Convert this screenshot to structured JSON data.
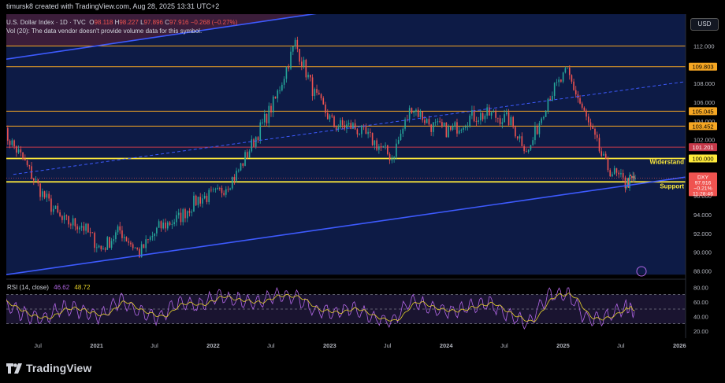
{
  "header": {
    "caption": "timursk8 created with TradingView.com, Aug 28, 2025 13:31 UTC+2",
    "symbol_title": "U.S. Dollar Index · 1D · TVC",
    "ohlc": {
      "o_label": "O",
      "o": "98.118",
      "h_label": "H",
      "h": "98.227",
      "l_label": "L",
      "l": "97.896",
      "c_label": "C",
      "c": "97.916",
      "change": "−0.268 (−0.27%)"
    },
    "volume_note": "Vol (20): The data vendor doesn't provide volume data for this symbol.",
    "currency": "USD"
  },
  "footer": {
    "brand": "TradingView"
  },
  "colors": {
    "background": "#000000",
    "channel_fill": "#0d1b46",
    "top_zone": "#3b1d3a",
    "channel_line": "#3d5afe",
    "yellow_line": "#ffeb3b",
    "orange_line": "#f5a623",
    "red_line": "#c6394a",
    "up_candle": "#26a69a",
    "down_candle": "#ef5350",
    "rsi_line": "#b267e6",
    "rsi_ma": "#e6d22a"
  },
  "chart_data": {
    "type": "line",
    "symbol": "DXY",
    "price_axis": {
      "ticks": [
        "114.000",
        "112.000",
        "110.000",
        "108.000",
        "106.000",
        "104.000",
        "102.000",
        "100.000",
        "98.000",
        "96.000",
        "94.000",
        "92.000",
        "90.000",
        "88.000"
      ],
      "ylim": [
        87.2,
        115.4
      ]
    },
    "time_axis": {
      "ticks": [
        "Jul",
        "2021",
        "Jul",
        "2022",
        "Jul",
        "2023",
        "Jul",
        "2024",
        "Jul",
        "2025",
        "Jul",
        "2026"
      ],
      "xlim": [
        "2020-03-24",
        "2026-01-20"
      ]
    },
    "x": [
      "2020-03",
      "2020-05",
      "2020-07",
      "2020-09",
      "2020-11",
      "2021-01",
      "2021-03",
      "2021-05",
      "2021-07",
      "2021-09",
      "2021-11",
      "2022-01",
      "2022-03",
      "2022-05",
      "2022-07",
      "2022-09",
      "2022-11",
      "2023-01",
      "2023-03",
      "2023-05",
      "2023-07",
      "2023-09",
      "2023-11",
      "2024-01",
      "2024-03",
      "2024-05",
      "2024-07",
      "2024-09",
      "2024-11",
      "2025-01",
      "2025-03",
      "2025-05",
      "2025-07",
      "2025-08"
    ],
    "close": [
      102.9,
      99.9,
      96.2,
      93.3,
      92.9,
      90.3,
      92.3,
      89.9,
      92.6,
      93.6,
      95.7,
      96.2,
      98.3,
      102.3,
      106.3,
      112.3,
      106.8,
      103.5,
      103.4,
      101.9,
      100.1,
      105.6,
      103.5,
      102.9,
      104.4,
      104.7,
      104.1,
      100.7,
      106.5,
      109.2,
      104.2,
      99.2,
      97.3,
      97.9
    ],
    "levels": [
      {
        "value": 112.0,
        "label": "",
        "color": "orange"
      },
      {
        "value": 109.803,
        "label": "109.803",
        "color": "orange"
      },
      {
        "value": 105.045,
        "label": "105.045",
        "color": "orange"
      },
      {
        "value": 103.452,
        "label": "103.452",
        "color": "orange"
      },
      {
        "value": 101.201,
        "label": "101.201",
        "color": "red"
      },
      {
        "value": 100.0,
        "label": "100.000",
        "color": "yellow",
        "annotation": "Widerstand"
      },
      {
        "value": 97.5,
        "label": "97.500",
        "color": "yellow",
        "annotation": "Support"
      }
    ],
    "last_price": {
      "symbol": "DXY",
      "price": "97.916",
      "change": "−0.21%",
      "countdown": "11:28:46"
    },
    "channel": {
      "upper": [
        [
          "2020-03-24",
          110.6
        ],
        [
          "2024-03-01",
          117.8
        ]
      ],
      "lower": [
        [
          "2020-03-24",
          87.6
        ],
        [
          "2025-08-28",
          97.3
        ]
      ],
      "mid_dashed": [
        [
          "2020-04-15",
          98.3
        ],
        [
          "2026-01-20",
          108.2
        ]
      ]
    },
    "rsi": {
      "title": "RSI (14, close)",
      "value": "46.62",
      "ma_value": "48.72",
      "axis_ticks": [
        "80.00",
        "60.00",
        "40.00",
        "20.00"
      ],
      "ylim": [
        10,
        90
      ],
      "bands": [
        70,
        50,
        30
      ],
      "values": [
        58,
        44,
        36,
        52,
        48,
        40,
        63,
        45,
        38,
        60,
        55,
        68,
        62,
        57,
        71,
        66,
        48,
        45,
        52,
        38,
        33,
        62,
        50,
        46,
        54,
        58,
        41,
        30,
        69,
        72,
        36,
        38,
        54,
        47
      ]
    }
  }
}
